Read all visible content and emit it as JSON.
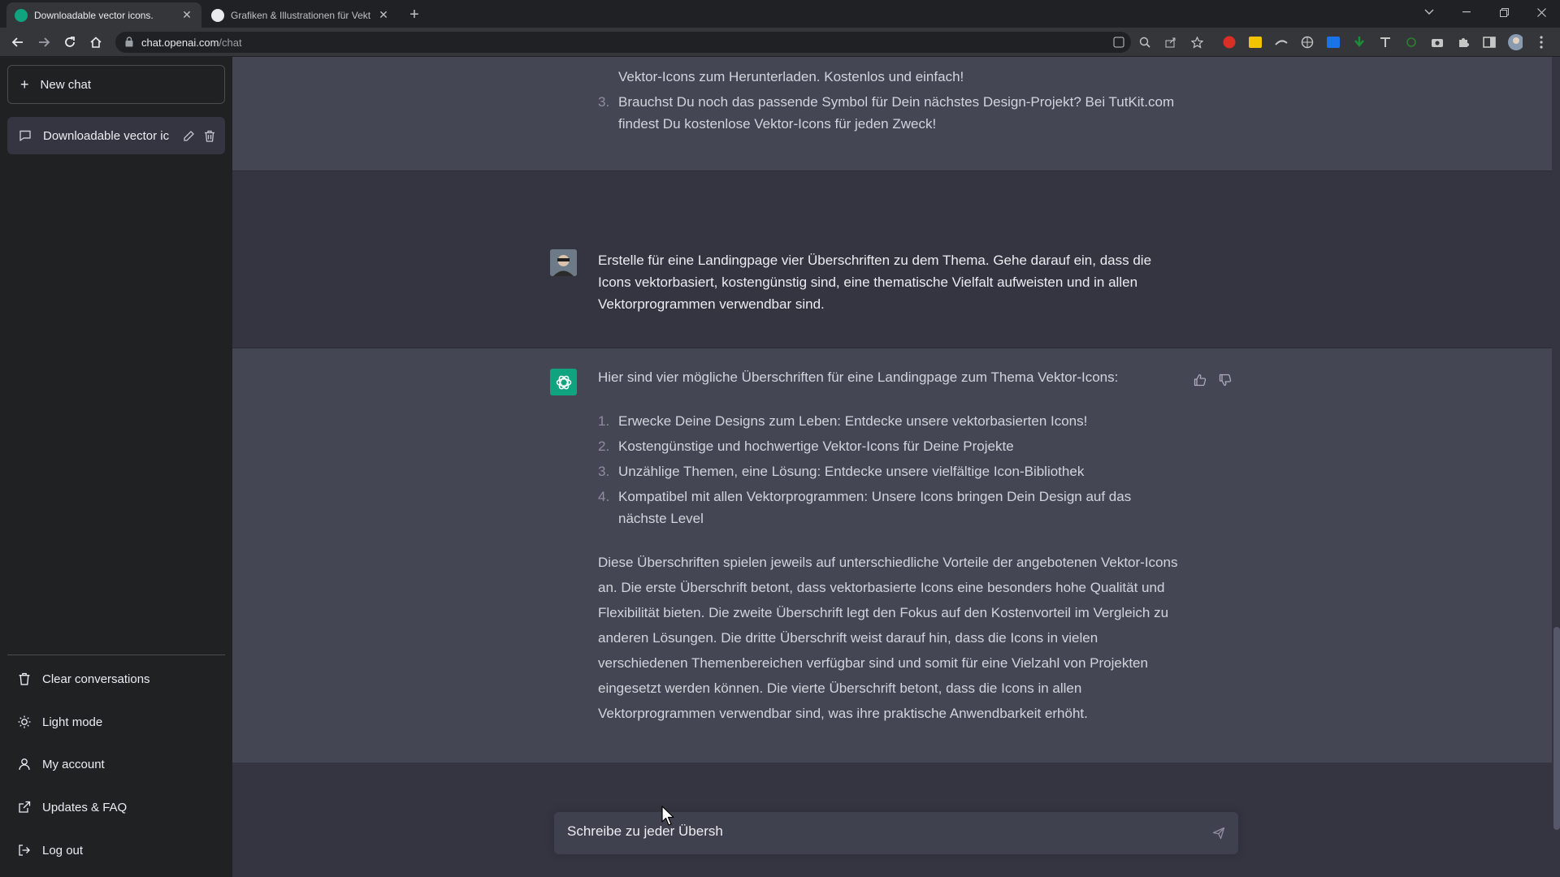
{
  "browser": {
    "tabs": [
      {
        "title": "Downloadable vector icons.",
        "active": true,
        "favicon_color": "#10a37f"
      },
      {
        "title": "Grafiken & Illustrationen für Vekt",
        "active": false,
        "favicon_color": "#e8eaed"
      }
    ],
    "url_host": "chat.openai.com",
    "url_path": "/chat"
  },
  "sidebar": {
    "new_chat_label": "New chat",
    "conversation_title": "Downloadable vector ic",
    "menu": {
      "clear": "Clear conversations",
      "light_mode": "Light mode",
      "account": "My account",
      "updates": "Updates & FAQ",
      "logout": "Log out"
    }
  },
  "chat": {
    "prev_reply_tail": {
      "item2_tail": "Vektor-Icons zum Herunterladen. Kostenlos und einfach!",
      "item3_num": "3.",
      "item3_text": "Brauchst Du noch das passende Symbol für Dein nächstes Design-Projekt? Bei TutKit.com findest Du kostenlose Vektor-Icons für jeden Zweck!"
    },
    "user_message": "Erstelle für eine Landingpage vier Überschriften zu dem Thema. Gehe darauf ein, dass die Icons vektorbasiert, kostengünstig sind, eine thematische Vielfalt aufweisten und in allen Vektorprogrammen verwendbar sind.",
    "ai_reply": {
      "intro": "Hier sind vier mögliche Überschriften für eine Landingpage zum Thema Vektor-Icons:",
      "items": [
        {
          "num": "1.",
          "text": "Erwecke Deine Designs zum Leben: Entdecke unsere vektorbasierten Icons!"
        },
        {
          "num": "2.",
          "text": "Kostengünstige und hochwertige Vektor-Icons für Deine Projekte"
        },
        {
          "num": "3.",
          "text": "Unzählige Themen, eine Lösung: Entdecke unsere vielfältige Icon-Bibliothek"
        },
        {
          "num": "4.",
          "text": "Kompatibel mit allen Vektorprogrammen: Unsere Icons bringen Dein Design auf das nächste Level"
        }
      ],
      "paragraph": "Diese Überschriften spielen jeweils auf unterschiedliche Vorteile der angebotenen Vektor-Icons an. Die erste Überschrift betont, dass vektorbasierte Icons eine besonders hohe Qualität und Flexibilität bieten. Die zweite Überschrift legt den Fokus auf den Kostenvorteil im Vergleich zu anderen Lösungen. Die dritte Überschrift weist darauf hin, dass die Icons in vielen verschiedenen Themenbereichen verfügbar sind und somit für eine Vielzahl von Projekten eingesetzt werden können. Die vierte Überschrift betont, dass die Icons in allen Vektorprogrammen verwendbar sind, was ihre praktische Anwendbarkeit erhöht."
    }
  },
  "composer": {
    "value": "Schreibe zu jeder Übersh"
  },
  "colors": {
    "sidebar_bg": "#202123",
    "main_bg": "#343541",
    "ai_band_bg": "#444654",
    "brand_green": "#10a37f"
  }
}
